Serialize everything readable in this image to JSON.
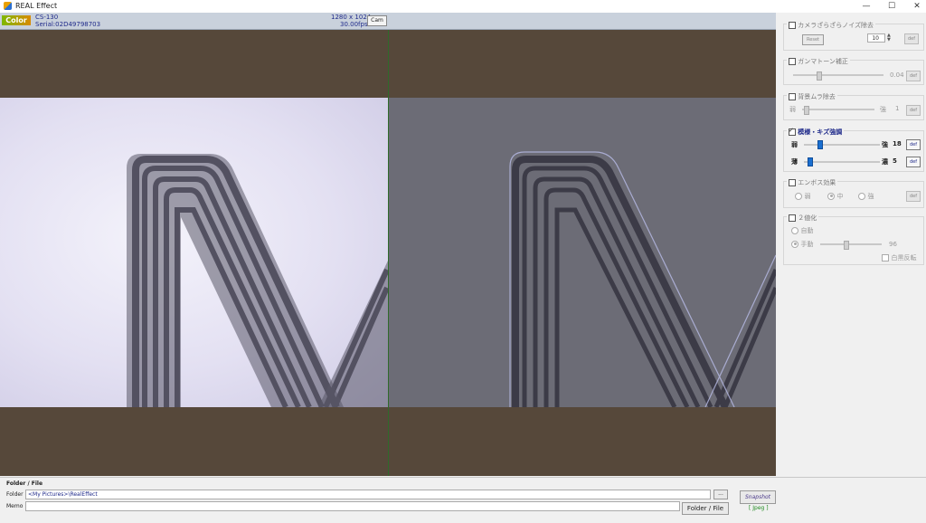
{
  "window": {
    "title": "REAL Effect",
    "minimize": "—",
    "maximize": "☐",
    "close": "✕"
  },
  "camera": {
    "color_badge": "Color",
    "model": "CS-130",
    "serial": "Serial:02D49798703",
    "resolution": "1280 x 1024",
    "fps": "30.00fps",
    "cam_button": "Cam"
  },
  "panel": {
    "noise": {
      "title": "カメラざらざらノイズ除去",
      "checked": false,
      "reset_label": "Reset",
      "value": "10",
      "def_label": "def"
    },
    "gamma": {
      "title": "ガンマトーン補正",
      "checked": false,
      "value": "0.04",
      "def_label": "def"
    },
    "background": {
      "title": "背景ムラ除去",
      "checked": false,
      "weak_label": "弱",
      "strong_label": "強",
      "value": "1",
      "level": 0.02,
      "def_label": "def"
    },
    "pattern": {
      "title": "模様・キズ強調",
      "checked": true,
      "row1": {
        "left": "弱",
        "right": "強",
        "value": "18",
        "level": 0.18
      },
      "row2": {
        "left": "薄",
        "right": "濃",
        "value": "5",
        "level": 0.05
      },
      "def_label": "def"
    },
    "emboss": {
      "title": "エンボス効果",
      "checked": false,
      "options": [
        "弱",
        "中",
        "強"
      ],
      "selected": "中",
      "def_label": "def"
    },
    "binarize": {
      "title": "２値化",
      "checked": false,
      "auto_label": "自動",
      "manual_label": "手動",
      "value": "96",
      "invert_label": "白黒反転"
    }
  },
  "bottom": {
    "section_title": "Folder / File",
    "folder_label": "Folder",
    "folder_value": "<My Pictures>\\RealEffect",
    "browse_label": "...",
    "memo_label": "Memo",
    "memo_value": "",
    "folder_file_button": "Folder / File",
    "snapshot_button": "Snapshot",
    "format_label": "[ Jpeg ]"
  }
}
